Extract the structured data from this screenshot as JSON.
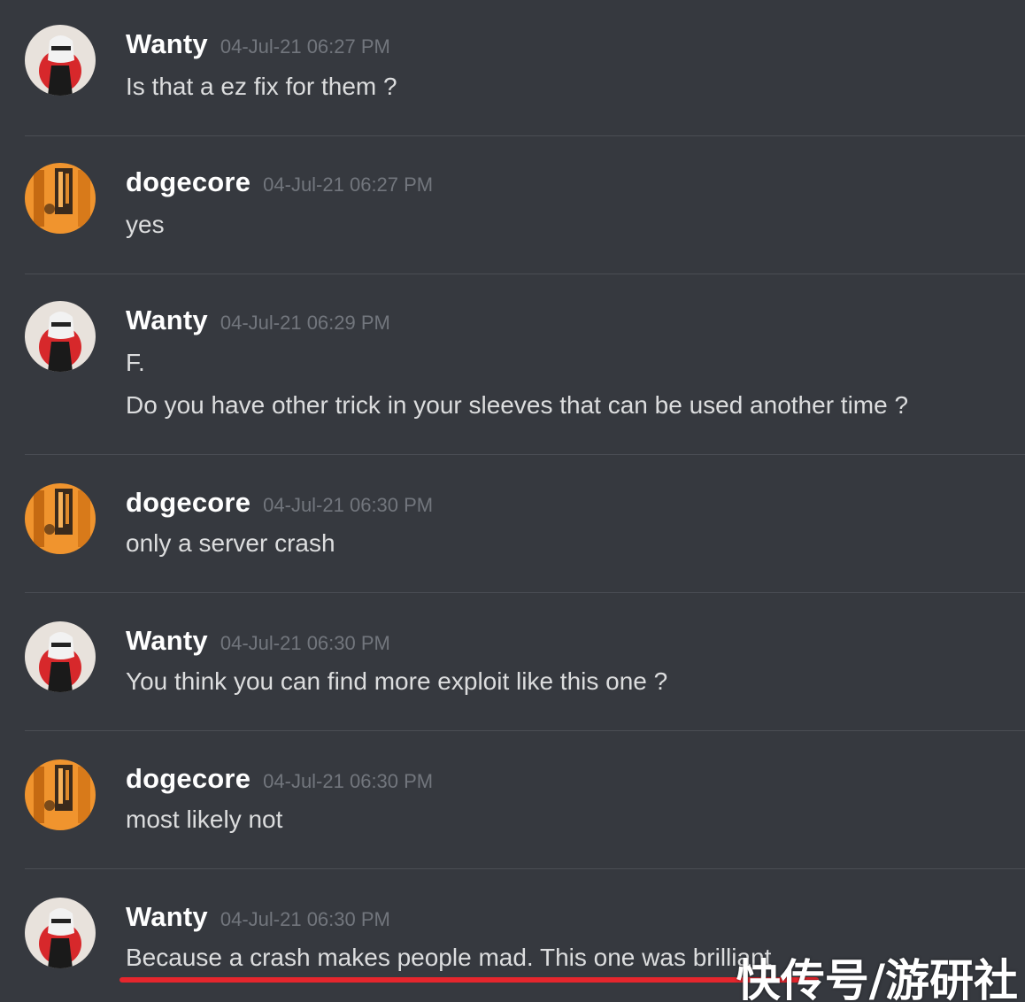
{
  "messages": [
    {
      "author": "Wanty",
      "timestamp": "04-Jul-21 06:27 PM",
      "avatar": "wanty-avatar",
      "lines": [
        "Is that a ez fix for them ?"
      ]
    },
    {
      "author": "dogecore",
      "timestamp": "04-Jul-21 06:27 PM",
      "avatar": "dogecore-avatar",
      "lines": [
        "yes"
      ]
    },
    {
      "author": "Wanty",
      "timestamp": "04-Jul-21 06:29 PM",
      "avatar": "wanty-avatar",
      "lines": [
        "F.",
        "Do you have other trick in your sleeves that can be used another time ?"
      ]
    },
    {
      "author": "dogecore",
      "timestamp": "04-Jul-21 06:30 PM",
      "avatar": "dogecore-avatar",
      "lines": [
        "only a server crash"
      ]
    },
    {
      "author": "Wanty",
      "timestamp": "04-Jul-21 06:30 PM",
      "avatar": "wanty-avatar",
      "lines": [
        "You think you can find more exploit like this one ?"
      ]
    },
    {
      "author": "dogecore",
      "timestamp": "04-Jul-21 06:30 PM",
      "avatar": "dogecore-avatar",
      "lines": [
        "most likely not"
      ]
    },
    {
      "author": "Wanty",
      "timestamp": "04-Jul-21 06:30 PM",
      "avatar": "wanty-avatar",
      "lines": [
        "Because a crash makes people mad. This one was brilliant"
      ]
    }
  ],
  "watermark": "快传号/游研社",
  "colors": {
    "background": "#36393f",
    "author": "#ffffff",
    "timestamp": "#72767d",
    "message_text": "#dcddde",
    "divider": "#4a4d54",
    "highlight_underline": "#e5262d"
  }
}
